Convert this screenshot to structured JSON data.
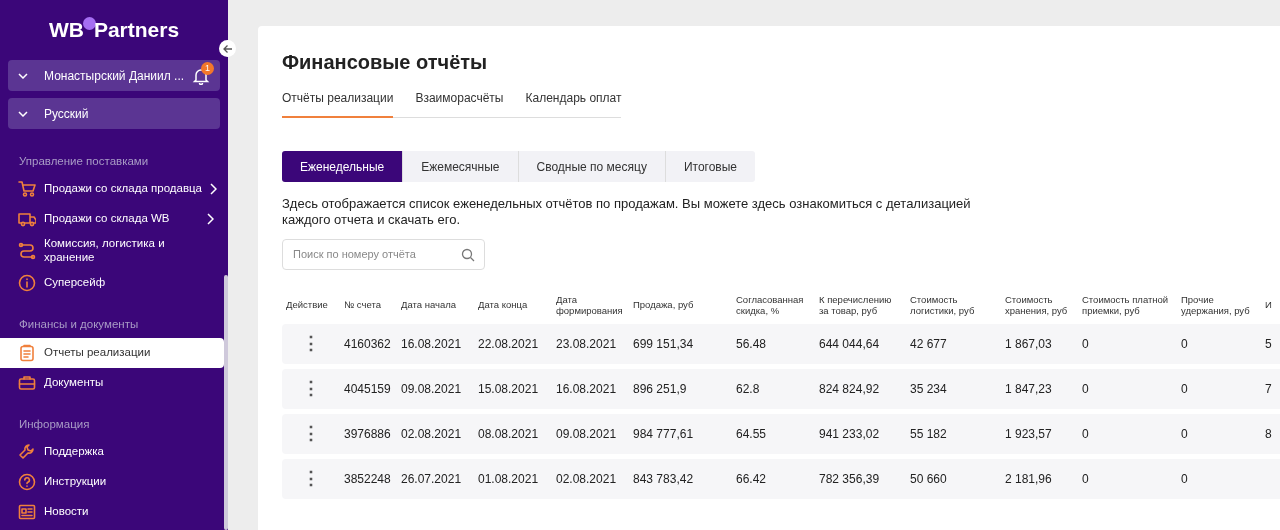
{
  "sidebar": {
    "logo": {
      "left": "WB",
      "right": "Partners"
    },
    "account": {
      "name": "Монастырский Даниил ...",
      "notifications": "1"
    },
    "language": "Русский",
    "sections": [
      {
        "title": "Управление поставками",
        "items": [
          {
            "label": "Продажи со склада продавца",
            "has_submenu": true,
            "selected": false
          },
          {
            "label": "Продажи со склада WB",
            "has_submenu": true,
            "selected": false
          },
          {
            "label": "Комиссия, логистика и хранение",
            "has_submenu": false,
            "selected": false
          },
          {
            "label": "Суперсейф",
            "has_submenu": false,
            "selected": false
          }
        ]
      },
      {
        "title": "Финансы и документы",
        "items": [
          {
            "label": "Отчеты реализации",
            "has_submenu": false,
            "selected": true
          },
          {
            "label": "Документы",
            "has_submenu": false,
            "selected": false
          }
        ]
      },
      {
        "title": "Информация",
        "items": [
          {
            "label": "Поддержка",
            "has_submenu": false,
            "selected": false
          },
          {
            "label": "Инструкции",
            "has_submenu": false,
            "selected": false
          },
          {
            "label": "Новости",
            "has_submenu": false,
            "selected": false
          }
        ]
      }
    ]
  },
  "page": {
    "title": "Финансовые отчёты",
    "tabs": [
      {
        "label": "Отчёты реализации",
        "selected": true
      },
      {
        "label": "Взаиморасчёты",
        "selected": false
      },
      {
        "label": "Календарь оплат",
        "selected": false
      }
    ],
    "segments": [
      {
        "label": "Еженедельные",
        "selected": true
      },
      {
        "label": "Ежемесячные",
        "selected": false
      },
      {
        "label": "Сводные по месяцу",
        "selected": false
      },
      {
        "label": "Итоговые",
        "selected": false
      }
    ],
    "description": "Здесь отображается список еженедельных отчётов по продажам. Вы можете здесь ознакомиться с детализацией каждого отчета и скачать его.",
    "search": {
      "placeholder": "Поиск по номеру отчёта"
    },
    "table": {
      "columns": [
        "Действие",
        "№ счета",
        "Дата начала",
        "Дата конца",
        "Дата формирования",
        "Продажа, руб",
        "Согласованная скидка, %",
        "К перечислению за товар, руб",
        "Стоимость логистики, руб",
        "Стоимость хранения, руб",
        "Стоимость платной приемки, руб",
        "Прочие удержания, руб",
        "И"
      ],
      "rows": [
        {
          "cells": [
            "⋮",
            "4160362",
            "16.08.2021",
            "22.08.2021",
            "23.08.2021",
            "699 151,34",
            "56.48",
            "644 044,64",
            "42 677",
            "1 867,03",
            "0",
            "0",
            "5"
          ]
        },
        {
          "cells": [
            "⋮",
            "4045159",
            "09.08.2021",
            "15.08.2021",
            "16.08.2021",
            "896 251,9",
            "62.8",
            "824 824,92",
            "35 234",
            "1 847,23",
            "0",
            "0",
            "7"
          ]
        },
        {
          "cells": [
            "⋮",
            "3976886",
            "02.08.2021",
            "08.08.2021",
            "09.08.2021",
            "984 777,61",
            "64.55",
            "941 233,02",
            "55 182",
            "1 923,57",
            "0",
            "0",
            "8"
          ]
        },
        {
          "cells": [
            "⋮",
            "3852248",
            "26.07.2021",
            "01.08.2021",
            "02.08.2021",
            "843 783,42",
            "66.42",
            "782 356,39",
            "50 660",
            "2 181,96",
            "0",
            "0"
          ]
        }
      ]
    }
  }
}
